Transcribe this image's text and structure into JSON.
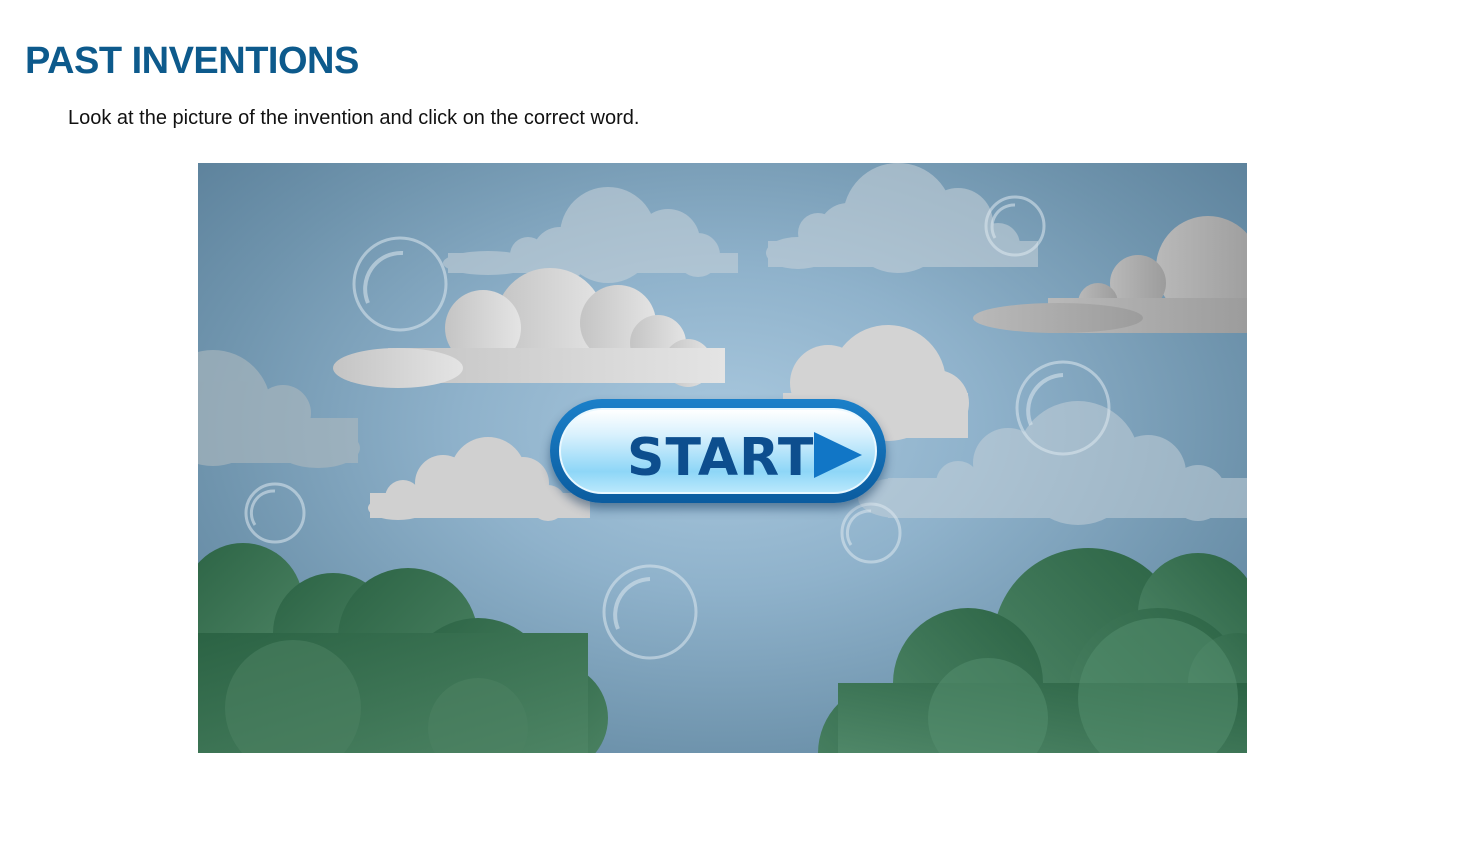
{
  "header": {
    "title": "PAST INVENTIONS",
    "instructions": "Look at the picture of the invention and click on the correct word."
  },
  "game": {
    "start_label": "START",
    "start_icon": "play-triangle-icon",
    "colors": {
      "title": "#0d5a8c",
      "button_border": "#0b5c9f",
      "button_text": "#0d4e8e",
      "sky": "#8fb2cb",
      "foliage": "#3f7857"
    }
  }
}
